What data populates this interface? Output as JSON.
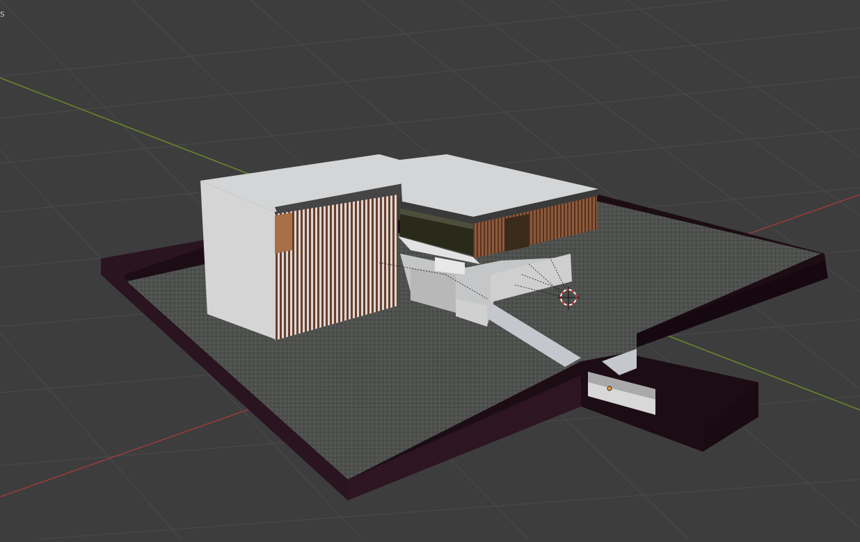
{
  "viewport": {
    "corner_text": "s",
    "background": "#3d3d3d",
    "grid_color": "#555555",
    "axis_x_color": "#9c3b3b",
    "axis_y_color": "#6d8a2a",
    "wall_color": "#1f0f17",
    "gravel_color": "#4d4f4d",
    "slab_color": "#d3d5d6",
    "wood_color": "#6b3d26"
  }
}
